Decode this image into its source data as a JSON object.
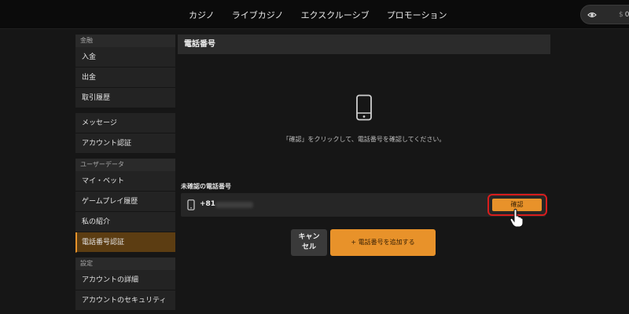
{
  "top_nav": {
    "items": [
      "カジノ",
      "ライブカジノ",
      "エクスクルーシブ",
      "プロモーション"
    ],
    "balance": {
      "currency": "$",
      "amount": "0"
    }
  },
  "sidebar": {
    "groups": [
      {
        "header": "金融",
        "items": [
          "入金",
          "出金",
          "取引履歴"
        ]
      },
      {
        "header": "",
        "items": [
          "メッセージ",
          "アカウント認証"
        ]
      },
      {
        "header": "ユーザーデータ",
        "items": [
          "マイ・ベット",
          "ゲームプレイ履歴",
          "私の紹介",
          "電話番号認証"
        ]
      },
      {
        "header": "設定",
        "items": [
          "アカウントの詳細",
          "アカウントのセキュリティ"
        ]
      }
    ],
    "active_item": "電話番号認証"
  },
  "main": {
    "title": "電話番号",
    "instruction": "「確認」をクリックして、電話番号を確認してください。",
    "unverified_label": "未確認の電話番号",
    "phone_code": "+81",
    "confirm_label": "確認",
    "cancel_label_line1": "キャン",
    "cancel_label_line2": "セル",
    "add_label": "+ 電話番号を追加する"
  },
  "colors": {
    "accent": "#e8922a",
    "active_bg": "#5c3d12",
    "highlight_border": "#d81d1d",
    "background": "#161616"
  },
  "icons": [
    "eye-icon",
    "phone-icon",
    "hand-cursor-icon"
  ]
}
